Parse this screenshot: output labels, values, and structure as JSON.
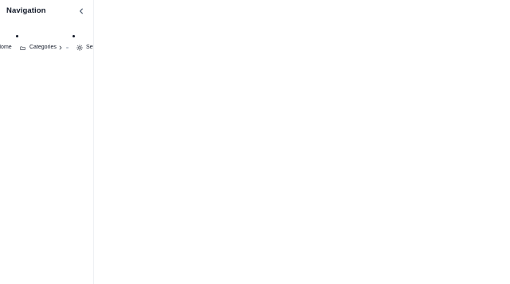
{
  "sidebar": {
    "title": "Navigation",
    "collapse_icon": "chevron-left-icon",
    "items": [
      {
        "label": "Home",
        "visible_text": "Home",
        "icon": null
      },
      {
        "label": "Categories",
        "icon": "folder-icon",
        "trailing_icons": [
          "chevron-right-icon",
          "dash-icon"
        ]
      },
      {
        "label": "Set",
        "icon": "gear-icon"
      }
    ]
  },
  "colors": {
    "background": "#ffffff",
    "text": "#111827",
    "divider": "#eef0f3",
    "muted_icon": "#64748b"
  }
}
